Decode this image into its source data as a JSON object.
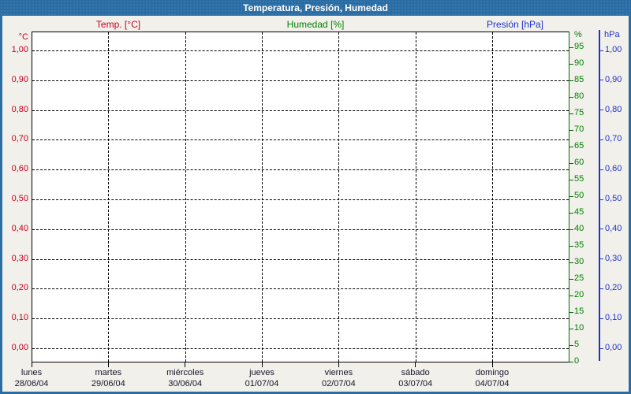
{
  "window": {
    "title": "Temperatura, Presión, Humedad"
  },
  "colors": {
    "frame_blue": "#2A6DA4",
    "background": "#F1F0EA",
    "plot_background": "#FFFFFF",
    "gridline": "#000000",
    "temp_red": "#CC0022",
    "humidity_green": "#008000",
    "humidity_axis_green": "#066806",
    "pressure_blue": "#2233CC",
    "date_text": "#15152A"
  },
  "legend": {
    "temp": "Temp. [°C]",
    "humidity": "Humedad [%]",
    "pressure": "Presión [hPa]"
  },
  "axes": {
    "temp": {
      "unit": "°C",
      "ticks": [
        "1,00",
        "0,90",
        "0,80",
        "0,70",
        "0,60",
        "0,50",
        "0,40",
        "0,30",
        "0,20",
        "0,10",
        "0,00"
      ]
    },
    "pressure": {
      "unit": "hPa",
      "ticks": [
        "1,00",
        "0,90",
        "0,80",
        "0,70",
        "0,60",
        "0,50",
        "0,40",
        "0,30",
        "0,20",
        "0,10",
        "0,00"
      ]
    },
    "humidity": {
      "unit": "%",
      "ticks": [
        "95",
        "90",
        "85",
        "80",
        "75",
        "70",
        "65",
        "60",
        "55",
        "50",
        "45",
        "40",
        "35",
        "30",
        "25",
        "20",
        "15",
        "10",
        "5",
        "0"
      ]
    },
    "days": [
      {
        "name": "lunes",
        "date": "28/06/04"
      },
      {
        "name": "martes",
        "date": "29/06/04"
      },
      {
        "name": "miércoles",
        "date": "30/06/04"
      },
      {
        "name": "jueves",
        "date": "01/07/04"
      },
      {
        "name": "viernes",
        "date": "02/07/04"
      },
      {
        "name": "sábado",
        "date": "03/07/04"
      },
      {
        "name": "domingo",
        "date": "04/07/04"
      }
    ]
  },
  "chart_data": {
    "type": "line",
    "title": "Temperatura, Presión, Humedad",
    "x_axis": {
      "categories": [
        "28/06/04",
        "29/06/04",
        "30/06/04",
        "01/07/04",
        "02/07/04",
        "03/07/04",
        "04/07/04"
      ],
      "day_names": [
        "lunes",
        "martes",
        "miércoles",
        "jueves",
        "viernes",
        "sábado",
        "domingo"
      ]
    },
    "y_axes": [
      {
        "name": "Temp.",
        "unit": "°C",
        "range": [
          0.0,
          1.0
        ],
        "tick_step": 0.1,
        "side": "left",
        "color": "#CC0022"
      },
      {
        "name": "Humedad",
        "unit": "%",
        "range": [
          0,
          100
        ],
        "tick_step": 5,
        "side": "right",
        "color": "#008000"
      },
      {
        "name": "Presión",
        "unit": "hPa",
        "range": [
          0.0,
          1.0
        ],
        "tick_step": 0.1,
        "side": "right-outer",
        "color": "#2233CC"
      }
    ],
    "series": [
      {
        "name": "Temp. [°C]",
        "color": "#CC0022",
        "values": []
      },
      {
        "name": "Humedad [%]",
        "color": "#008000",
        "values": []
      },
      {
        "name": "Presión [hPa]",
        "color": "#2233CC",
        "values": []
      }
    ],
    "grid": true,
    "grid_style": "dashed",
    "legend_position": "top"
  }
}
